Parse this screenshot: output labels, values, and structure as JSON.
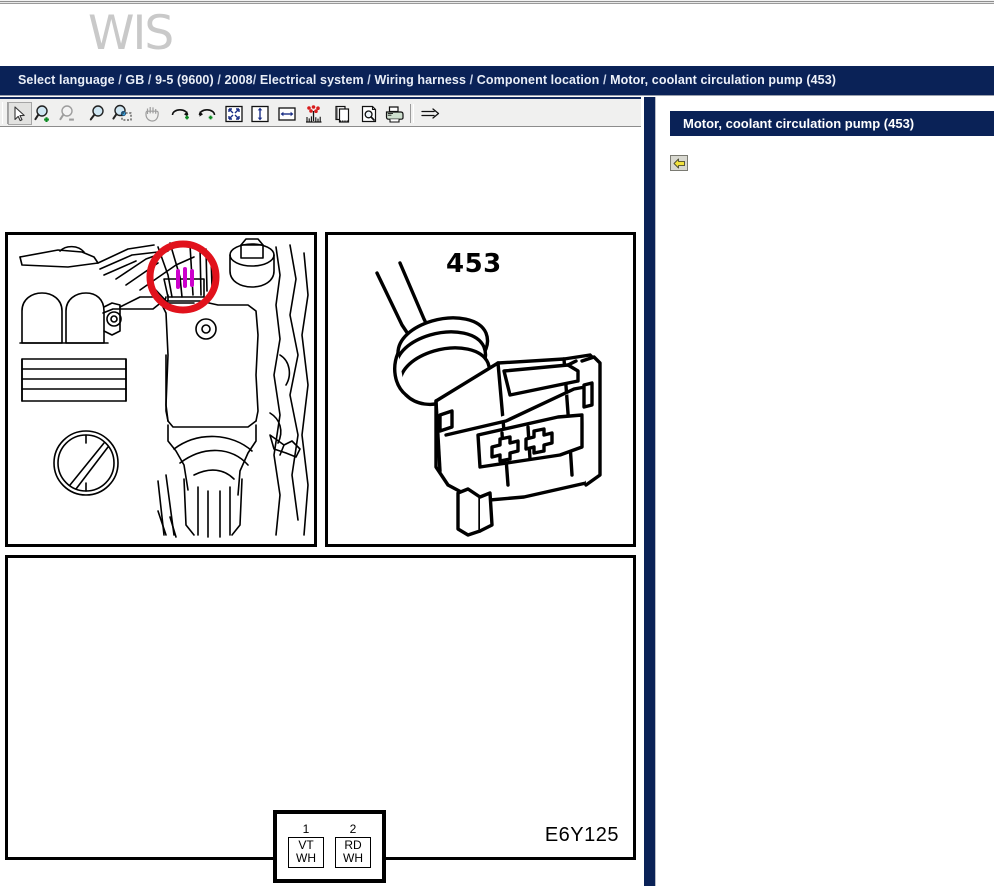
{
  "window": {
    "brand_logo": "WIS"
  },
  "breadcrumb": {
    "name": "breadcrumb-path",
    "separator": "/",
    "items": [
      "Select language",
      "GB",
      "9-5 (9600)",
      "2008",
      "Electrical system",
      "Wiring harness",
      "Component location",
      "Motor, coolant circulation pump (453)"
    ],
    "full_text": "Select language / GB / 9-5 (9600) / 2008/ Electrical system / Wiring harness / Component location / Motor, coolant circulation pump (453)"
  },
  "toolbar": {
    "buttons": [
      {
        "icon": "arrow-select-icon",
        "label": "Select",
        "selected": true,
        "enabled": true
      },
      {
        "icon": "zoom-in-icon",
        "label": "Zoom in",
        "selected": false,
        "enabled": true
      },
      {
        "icon": "zoom-out-icon",
        "label": "Zoom out",
        "selected": false,
        "enabled": false
      },
      {
        "icon": "zoom-icon",
        "label": "Zoom",
        "selected": false,
        "enabled": true
      },
      {
        "icon": "zoom-area-icon",
        "label": "Zoom to area",
        "selected": false,
        "enabled": true
      },
      {
        "icon": "pan-hand-icon",
        "label": "Pan",
        "selected": false,
        "enabled": false
      },
      {
        "icon": "rotate-cw-icon",
        "label": "Rotate clockwise",
        "selected": false,
        "enabled": true
      },
      {
        "icon": "rotate-ccw-icon",
        "label": "Rotate counter-clockwise",
        "selected": false,
        "enabled": true
      },
      {
        "icon": "fit-page-icon",
        "label": "Fit page",
        "selected": false,
        "enabled": true
      },
      {
        "icon": "fit-height-icon",
        "label": "Fit height",
        "selected": false,
        "enabled": true
      },
      {
        "icon": "fit-width-icon",
        "label": "Fit width",
        "selected": false,
        "enabled": true
      },
      {
        "icon": "highlight-icon",
        "label": "Highlight",
        "selected": false,
        "enabled": true
      },
      {
        "icon": "copy-page-icon",
        "label": "Copy page",
        "selected": false,
        "enabled": true
      },
      {
        "icon": "print-preview-icon",
        "label": "Print preview",
        "selected": false,
        "enabled": true
      },
      {
        "icon": "print-icon",
        "label": "Print",
        "selected": false,
        "enabled": true
      },
      {
        "icon": "next-arrow-icon",
        "label": "Next",
        "selected": false,
        "enabled": true
      }
    ]
  },
  "viewer": {
    "figures": {
      "component_location": {
        "name": "component-location-illustration",
        "highlight_color": "#e1121c",
        "marker_color": "#cc00cc"
      },
      "connector": {
        "name": "connector-illustration",
        "number": "453"
      },
      "pinout": {
        "name": "pinout-illustration",
        "drawing_code": "E6Y125",
        "pins": [
          {
            "number": "1",
            "wire_top": "VT",
            "wire_bottom": "WH"
          },
          {
            "number": "2",
            "wire_top": "RD",
            "wire_bottom": "WH"
          }
        ]
      }
    }
  },
  "info_pane": {
    "header_title": "Motor, coolant circulation pump (453)",
    "back_button_label": "Back",
    "back_icon": "arrow-left-icon"
  },
  "colors": {
    "navy": "#0a2257",
    "toolbar_bg": "#f0f0ef",
    "logo_gray": "#c9c9c9",
    "highlight_red": "#e1121c",
    "back_arrow_yellow": "#f2e23c"
  }
}
